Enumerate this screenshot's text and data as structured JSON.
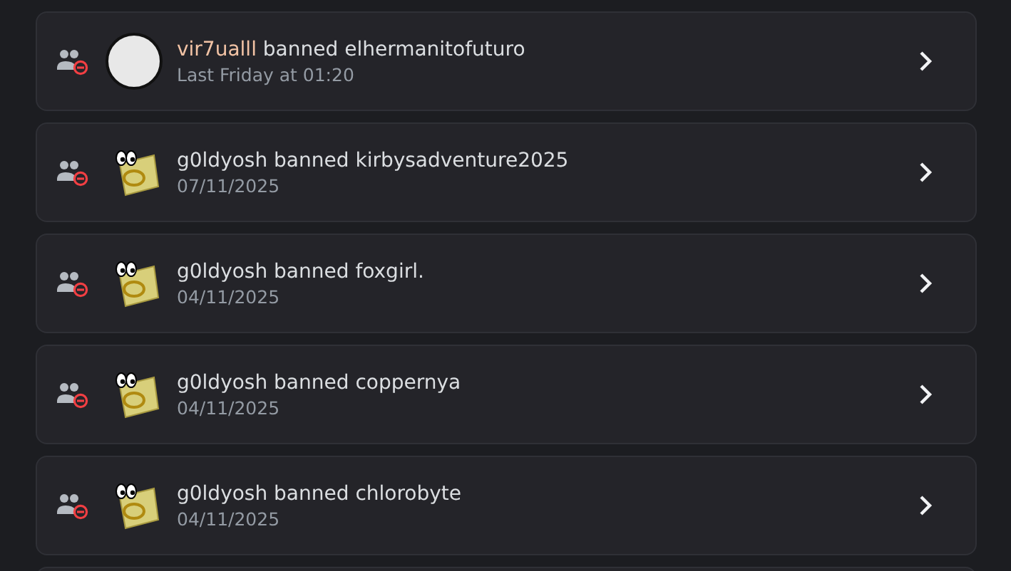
{
  "entries": [
    {
      "actor": "vir7ualll",
      "color": "#f2c3a5",
      "action": "banned",
      "target": "elhermanitofuturo",
      "time": "Last Friday at 01:20",
      "kind": "photo"
    },
    {
      "actor": "g0ldyosh",
      "color": "#dbdee1",
      "action": "banned",
      "target": "kirbysadventure2025",
      "time": "07/11/2025",
      "kind": "cartoon"
    },
    {
      "actor": "g0ldyosh",
      "color": "#dbdee1",
      "action": "banned",
      "target": "foxgirl.",
      "time": "04/11/2025",
      "kind": "cartoon"
    },
    {
      "actor": "g0ldyosh",
      "color": "#dbdee1",
      "action": "banned",
      "target": "coppernya",
      "time": "04/11/2025",
      "kind": "cartoon"
    },
    {
      "actor": "g0ldyosh",
      "color": "#dbdee1",
      "action": "banned",
      "target": "chlorobyte",
      "time": "04/11/2025",
      "kind": "cartoon"
    }
  ]
}
